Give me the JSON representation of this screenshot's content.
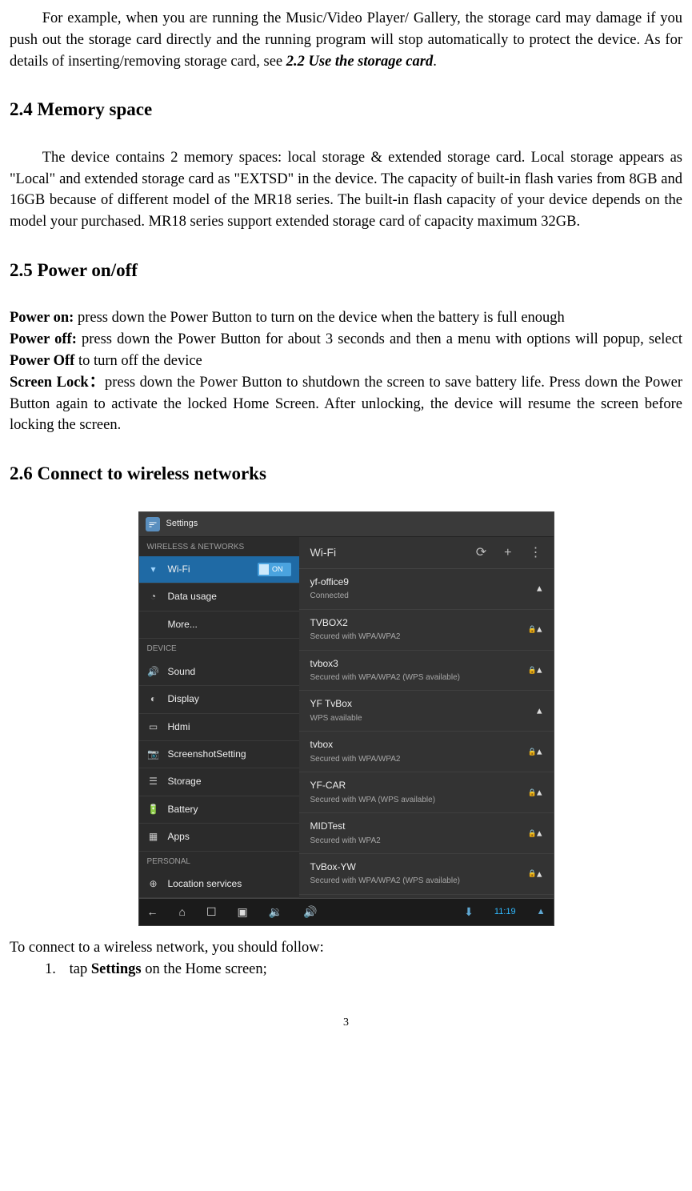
{
  "intro": {
    "text_before_ref": "For example, when you are running the Music/Video Player/ Gallery, the storage card may damage if you push out the storage card directly and the running program will stop automatically to protect the device. As for details of inserting/removing storage card, see ",
    "ref": "2.2 Use the storage card",
    "text_after_ref": "."
  },
  "sections": {
    "s24": {
      "title": "2.4 Memory space",
      "body": "The device contains 2 memory spaces: local storage & extended storage card. Local storage appears as \"Local\" and extended storage card as \"EXTSD\" in the device. The capacity of built-in flash varies from 8GB and 16GB because of different model of the MR18 series. The built-in flash capacity of your device depends on the model your purchased. MR18 series support extended storage card of capacity maximum 32GB."
    },
    "s25": {
      "title": "2.5 Power on/off",
      "power_on_label": "Power on:",
      "power_on_text": " press down the Power Button to turn on the device when the battery is full enough",
      "power_off_label": "Power off:",
      "power_off_text_before": " press down the Power Button for about 3 seconds and then a menu with options will popup, select ",
      "power_off_bold": "Power Off",
      "power_off_text_after": " to turn off the device",
      "screen_lock_label": "Screen Lock：",
      "screen_lock_text": "press down the Power Button to shutdown the screen to save battery life. Press down the Power Button again to activate the locked Home Screen. After unlocking, the device will resume the screen before locking the screen."
    },
    "s26": {
      "title": "2.6 Connect to wireless networks",
      "after_shot_text": "To connect to a wireless network, you should follow:",
      "step1_num": "1.",
      "step1_before": "tap ",
      "step1_bold": "Settings",
      "step1_after": " on the Home screen;"
    }
  },
  "screenshot": {
    "app_title": "Settings",
    "main_title": "Wi-Fi",
    "sidebar": {
      "cat1": "WIRELESS & NETWORKS",
      "cat2": "DEVICE",
      "cat3": "PERSONAL",
      "items": [
        {
          "label": "Wi-Fi",
          "toggle": "ON",
          "selected": true
        },
        {
          "label": "Data usage"
        },
        {
          "label": "More..."
        },
        {
          "label": "Sound"
        },
        {
          "label": "Display"
        },
        {
          "label": "Hdmi"
        },
        {
          "label": "ScreenshotSetting"
        },
        {
          "label": "Storage"
        },
        {
          "label": "Battery"
        },
        {
          "label": "Apps"
        },
        {
          "label": "Location services"
        }
      ]
    },
    "networks": [
      {
        "name": "yf-office9",
        "status": "Connected",
        "secured": false
      },
      {
        "name": "TVBOX2",
        "status": "Secured with WPA/WPA2",
        "secured": true
      },
      {
        "name": "tvbox3",
        "status": "Secured with WPA/WPA2 (WPS available)",
        "secured": true
      },
      {
        "name": "YF TvBox",
        "status": "WPS available",
        "secured": false
      },
      {
        "name": "tvbox",
        "status": "Secured with WPA/WPA2",
        "secured": true
      },
      {
        "name": "YF-CAR",
        "status": "Secured with WPA (WPS available)",
        "secured": true
      },
      {
        "name": "MIDTest",
        "status": "Secured with WPA2",
        "secured": true
      },
      {
        "name": "TvBox-YW",
        "status": "Secured with WPA/WPA2 (WPS available)",
        "secured": true
      }
    ],
    "clock": "11:19",
    "header_icons": {
      "scan": "⟳",
      "add": "+",
      "menu": "⋮"
    }
  },
  "page_number": "3"
}
